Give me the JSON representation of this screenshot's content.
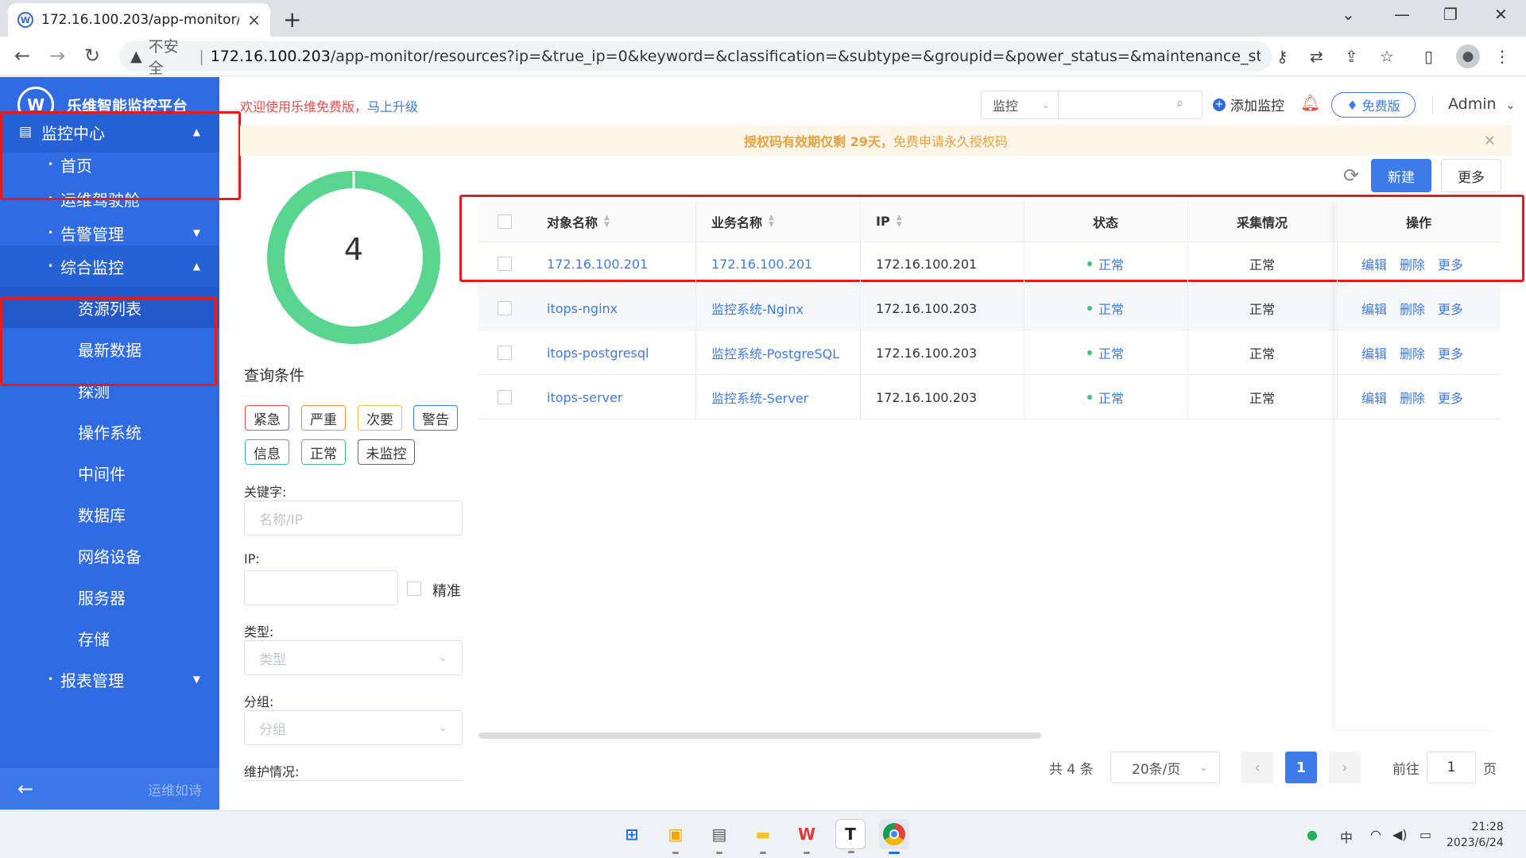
{
  "browser": {
    "tab_title": "172.16.100.203/app-monitor/r",
    "favicon": "W",
    "new_tab": "+",
    "security_label": "不安全",
    "url_host": "172.16.100.203",
    "url_path": "/app-monitor/resources?ip=&true_ip=0&keyword=&classification=&subtype=&groupid=&power_status=&maintenance_sta..."
  },
  "sidebar": {
    "logo_mark": "W",
    "app_name": "乐维智能监控平台",
    "items": [
      {
        "label": "监控中心",
        "level": "top",
        "chevron": "up"
      },
      {
        "label": "首页",
        "level": "bullet"
      },
      {
        "label": "运维驾驶舱",
        "level": "bullet"
      },
      {
        "label": "告警管理",
        "level": "bullet",
        "chevron": "down"
      },
      {
        "label": "综合监控",
        "level": "bullet",
        "chevron": "up"
      },
      {
        "label": "资源列表",
        "level": "sub"
      },
      {
        "label": "最新数据",
        "level": "sub"
      },
      {
        "label": "探测",
        "level": "sub"
      },
      {
        "label": "操作系统",
        "level": "sub"
      },
      {
        "label": "中间件",
        "level": "sub"
      },
      {
        "label": "数据库",
        "level": "sub"
      },
      {
        "label": "网络设备",
        "level": "sub"
      },
      {
        "label": "服务器",
        "level": "sub"
      },
      {
        "label": "存储",
        "level": "sub"
      },
      {
        "label": "报表管理",
        "level": "bullet",
        "chevron": "down"
      }
    ],
    "footer_motto": "运维如诗"
  },
  "header": {
    "promo_text": "欢迎使用乐维免费版，",
    "promo_link": "马上升级",
    "search_scope": "监控",
    "add_monitor": "添加监控",
    "edition_badge": "免费版",
    "user": "Admin"
  },
  "notice": {
    "prefix": "授权码有效期仅剩 29天，",
    "suffix": "免费申请永久授权码"
  },
  "summary": {
    "total": "4",
    "normal_color": "#5ad58f"
  },
  "filters": {
    "title": "查询条件",
    "severity_tags": [
      {
        "label": "紧急",
        "color": "#e54b4b"
      },
      {
        "label": "严重",
        "color": "#f08c3a"
      },
      {
        "label": "次要",
        "color": "#e6c13c"
      },
      {
        "label": "警告",
        "color": "#3c7be8"
      },
      {
        "label": "信息",
        "color": "#36b7c9"
      },
      {
        "label": "正常",
        "color": "#3ec27c"
      },
      {
        "label": "未监控",
        "color": "#666666"
      }
    ],
    "keyword_label": "关键字:",
    "keyword_placeholder": "名称/IP",
    "ip_label": "IP:",
    "ip_value": "",
    "exact_label": "精准",
    "type_label": "类型:",
    "type_placeholder": "类型",
    "group_label": "分组:",
    "group_placeholder": "分组",
    "maintenance_label": "维护情况:"
  },
  "toolbar": {
    "new_label": "新建",
    "more_label": "更多"
  },
  "table": {
    "columns": [
      "对象名称",
      "业务名称",
      "IP",
      "状态",
      "采集情况",
      "操作"
    ],
    "rows": [
      {
        "name": "172.16.100.201",
        "business": "172.16.100.201",
        "ip": "172.16.100.201",
        "status": "正常",
        "collect": "正常"
      },
      {
        "name": "itops-nginx",
        "business": "监控系统-Nginx",
        "ip": "172.16.100.203",
        "status": "正常",
        "collect": "正常"
      },
      {
        "name": "itops-postgresql",
        "business": "监控系统-PostgreSQL",
        "ip": "172.16.100.203",
        "status": "正常",
        "collect": "正常"
      },
      {
        "name": "itops-server",
        "business": "监控系统-Server",
        "ip": "172.16.100.203",
        "status": "正常",
        "collect": "正常"
      }
    ],
    "actions": [
      "编辑",
      "删除",
      "更多"
    ]
  },
  "pagination": {
    "total_text": "共 4 条",
    "page_size": "20条/页",
    "current_page": "1",
    "goto_label": "前往",
    "goto_value": "1",
    "page_suffix": "页"
  },
  "taskbar": {
    "ime": "中",
    "time": "21:28",
    "date": "2023/6/24"
  }
}
